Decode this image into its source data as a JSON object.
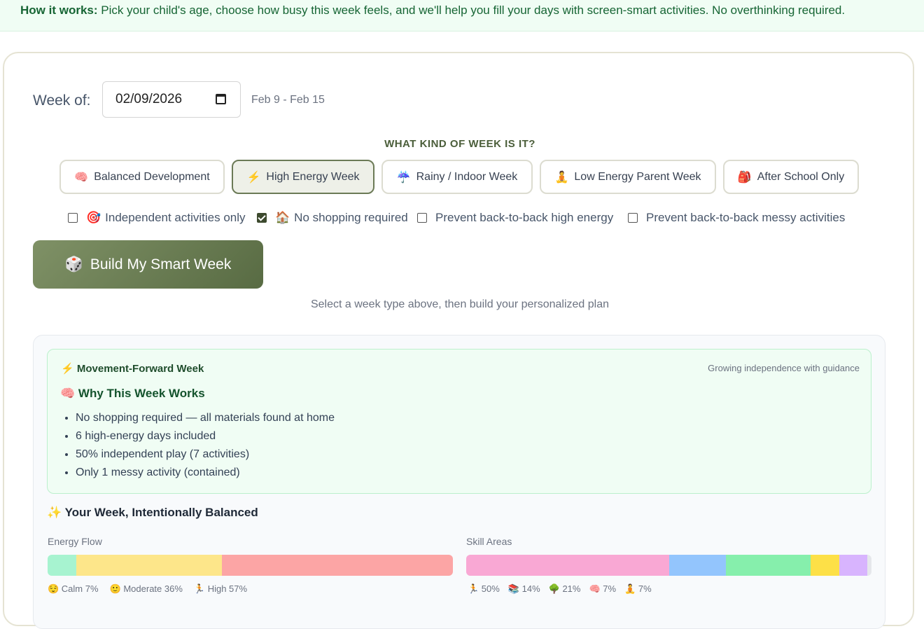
{
  "banner": {
    "lead": "How it works:",
    "text": " Pick your child's age, choose how busy this week feels, and we'll help you fill your days with screen-smart activities. No overthinking required."
  },
  "week": {
    "label": "Week of:",
    "date_value": "02/09/2026",
    "range": "Feb 9 - Feb 15"
  },
  "week_type": {
    "question": "WHAT KIND OF WEEK IS IT?",
    "options": [
      {
        "icon": "🧠",
        "label": "Balanced Development",
        "selected": false
      },
      {
        "icon": "⚡",
        "label": "High Energy Week",
        "selected": true
      },
      {
        "icon": "☔",
        "label": "Rainy / Indoor Week",
        "selected": false
      },
      {
        "icon": "🧘",
        "label": "Low Energy Parent Week",
        "selected": false
      },
      {
        "icon": "🎒",
        "label": "After School Only",
        "selected": false
      }
    ]
  },
  "filters": [
    {
      "icon": "🎯",
      "label": "Independent activities only",
      "checked": false
    },
    {
      "icon": "🏠",
      "label": "No shopping required",
      "checked": true
    },
    {
      "icon": "",
      "label": "Prevent back-to-back high energy",
      "checked": false
    },
    {
      "icon": "",
      "label": "Prevent back-to-back messy activities",
      "checked": false
    }
  ],
  "build": {
    "icon": "🎲",
    "label": "Build My Smart Week",
    "hint": "Select a week type above, then build your personalized plan"
  },
  "summary": {
    "tag_icon": "⚡",
    "tag": "Movement-Forward Week",
    "subtitle": "Growing independence with guidance",
    "title_icon": "🧠",
    "title": "Why This Week Works",
    "points": [
      "No shopping required — all materials found at home",
      "6 high-energy days included",
      "50% independent play (7 activities)",
      "Only 1 messy activity (contained)"
    ]
  },
  "balance": {
    "title_icon": "✨",
    "title": "Your Week, Intentionally Balanced",
    "energy": {
      "label": "Energy Flow",
      "segments": [
        {
          "icon": "😌",
          "name": "Calm",
          "value": "7%",
          "pct": 7,
          "color": "#a7f3d0"
        },
        {
          "icon": "🙂",
          "name": "Moderate",
          "value": "36%",
          "pct": 36,
          "color": "#fde68a"
        },
        {
          "icon": "🏃",
          "name": "High",
          "value": "57%",
          "pct": 57,
          "color": "#fca5a5"
        }
      ]
    },
    "skills": {
      "label": "Skill Areas",
      "segments": [
        {
          "icon": "🏃",
          "value": "50%",
          "pct": 50,
          "color": "#f9a8d4"
        },
        {
          "icon": "📚",
          "value": "14%",
          "pct": 14,
          "color": "#93c5fd"
        },
        {
          "icon": "🌳",
          "value": "21%",
          "pct": 21,
          "color": "#86efac"
        },
        {
          "icon": "🧠",
          "value": "7%",
          "pct": 7,
          "color": "#fde047"
        },
        {
          "icon": "🧘",
          "value": "7%",
          "pct": 7,
          "color": "#d8b4fe"
        }
      ]
    }
  }
}
